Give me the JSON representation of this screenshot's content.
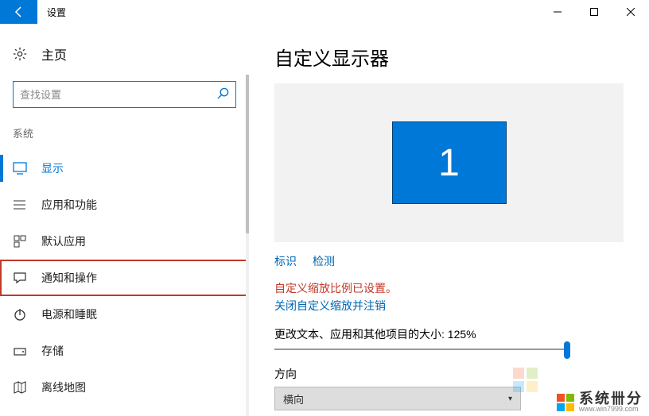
{
  "window": {
    "title": "设置",
    "back": "←"
  },
  "sidebar": {
    "home": "主页",
    "search_placeholder": "查找设置",
    "section": "系统",
    "items": [
      {
        "label": "显示",
        "icon": "monitor",
        "active": true
      },
      {
        "label": "应用和功能",
        "icon": "list"
      },
      {
        "label": "默认应用",
        "icon": "defaults"
      },
      {
        "label": "通知和操作",
        "icon": "chat",
        "highlighted": true
      },
      {
        "label": "电源和睡眠",
        "icon": "power"
      },
      {
        "label": "存储",
        "icon": "storage"
      },
      {
        "label": "离线地图",
        "icon": "map"
      }
    ]
  },
  "content": {
    "title": "自定义显示器",
    "monitor_number": "1",
    "link_identify": "标识",
    "link_detect": "检测",
    "warning": "自定义缩放比例已设置。",
    "disable_scaling": "关闭自定义缩放并注销",
    "scale_label": "更改文本、应用和其他项目的大小: 125%",
    "orientation_label": "方向",
    "orientation_value": "横向"
  },
  "watermark": {
    "brand": "系统卌分",
    "url": "www.win7999.com"
  }
}
